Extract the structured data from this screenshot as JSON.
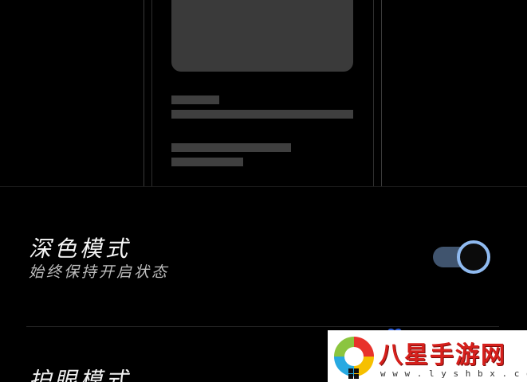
{
  "preview": {
    "description_hidden": ""
  },
  "dark_mode_setting": {
    "title": "深色模式",
    "subtitle": "始终保持开启状态",
    "toggle_on": true
  },
  "next_setting": {
    "title": "护眼模式"
  },
  "watermark": {
    "title": "八星手游网",
    "url": "w w w . l y s h b x . c o m"
  },
  "colors": {
    "background": "#000000",
    "toggle_track": "#40546e",
    "toggle_knob_border": "#8fbaf0",
    "placeholder": "#3a3a3a",
    "watermark_red": "#d6201c"
  },
  "icons": {
    "logo": "colorful-logo-icon",
    "windows": "windows-grid-icon"
  }
}
